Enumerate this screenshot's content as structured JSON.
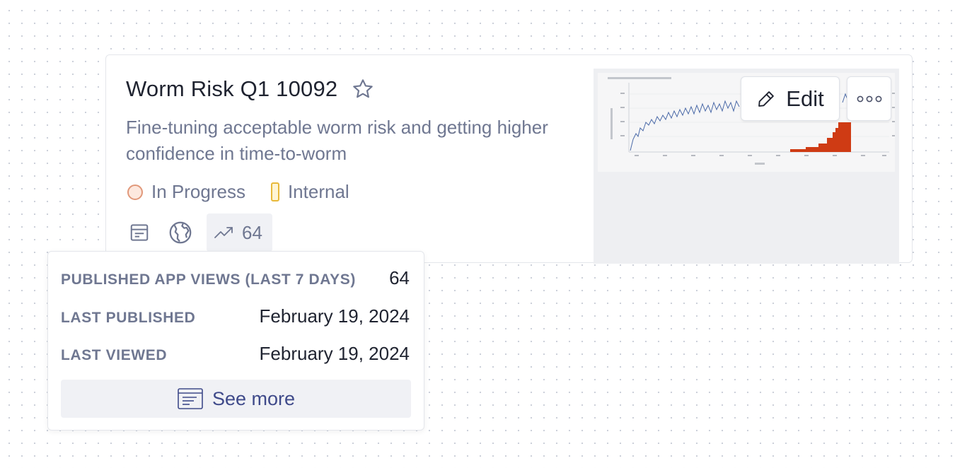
{
  "project": {
    "title": "Worm Risk Q1 10092",
    "description": "Fine-tuning acceptable worm risk and getting higher confidence in time-to-worm",
    "status": "In Progress",
    "category": "Internal",
    "views_count": "64"
  },
  "preview": {
    "edit_label": "Edit",
    "chart_line_color": "#4b6aa8",
    "chart_bar_color": "#cf3b14"
  },
  "popover": {
    "rows": [
      {
        "label": "PUBLISHED APP VIEWS (LAST 7 DAYS)",
        "value": "64"
      },
      {
        "label": "LAST PUBLISHED",
        "value": "February 19, 2024"
      },
      {
        "label": "LAST VIEWED",
        "value": "February 19, 2024"
      }
    ],
    "see_more_label": "See more"
  },
  "icons": {
    "star": "star-icon",
    "app": "app-layout-icon",
    "globe": "globe-icon",
    "trend": "trend-up-icon",
    "edit": "pencil-icon",
    "more": "more-dots-icon",
    "see_more": "document-icon"
  },
  "colors": {
    "status_in_progress": "#e1987a",
    "category_internal": "#e8b93a",
    "see_more_text": "#3f4a8a"
  }
}
